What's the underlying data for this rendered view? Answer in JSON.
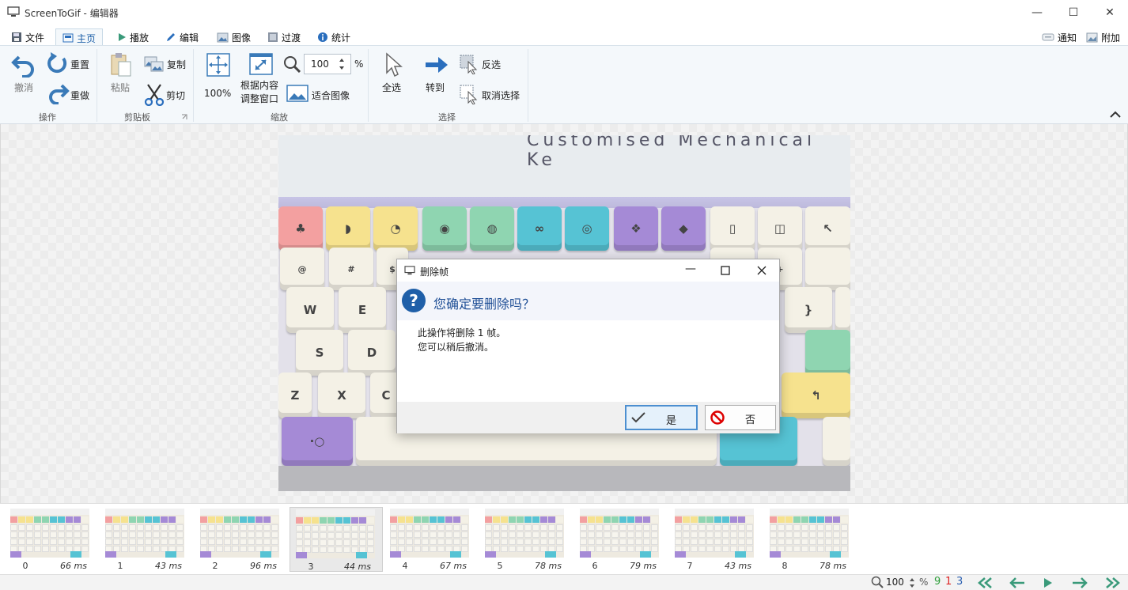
{
  "window": {
    "title": "ScreenToGif - 编辑器",
    "minimize_glyph": "—",
    "maximize_glyph": "☐",
    "close_glyph": "✕"
  },
  "tabs": [
    {
      "label": "文件",
      "icon": "save-icon"
    },
    {
      "label": "主页",
      "icon": "home-icon",
      "active": true
    },
    {
      "label": "播放",
      "icon": "play-icon"
    },
    {
      "label": "编辑",
      "icon": "pencil-icon"
    },
    {
      "label": "图像",
      "icon": "image-icon"
    },
    {
      "label": "过渡",
      "icon": "transition-icon"
    },
    {
      "label": "统计",
      "icon": "info-icon"
    }
  ],
  "right_tabs": [
    {
      "label": "通知",
      "icon": "notification-icon"
    },
    {
      "label": "附加",
      "icon": "extras-icon"
    }
  ],
  "ribbon": {
    "action": {
      "undo": "撤消",
      "reset": "重置",
      "redo": "重做",
      "group": "操作"
    },
    "clipboard": {
      "paste": "粘贴",
      "copy": "复制",
      "cut": "剪切",
      "group": "剪贴板"
    },
    "zoom": {
      "hundred": "100%",
      "fit_window": "根据内容\n调整窗口",
      "fit_image": "适合图像",
      "value": "100",
      "unit": "%",
      "group": "缩放"
    },
    "select": {
      "select_all": "全选",
      "goto": "转到",
      "invert": "反选",
      "deselect": "取消选择",
      "group": "选择"
    }
  },
  "frame_caption": "Customised Mechanical Ke",
  "dialog": {
    "title": "删除帧",
    "heading": "您确定要删除吗？",
    "line1": "此操作将删除 1 帧。",
    "line2": "您可以稍后撤消。",
    "yes": "是",
    "no": "否"
  },
  "frames": [
    {
      "num": "0",
      "dur": "66 ms"
    },
    {
      "num": "1",
      "dur": "43 ms"
    },
    {
      "num": "2",
      "dur": "96 ms"
    },
    {
      "num": "3",
      "dur": "44 ms",
      "selected": true
    },
    {
      "num": "4",
      "dur": "67 ms"
    },
    {
      "num": "5",
      "dur": "78 ms"
    },
    {
      "num": "6",
      "dur": "79 ms"
    },
    {
      "num": "7",
      "dur": "43 ms"
    },
    {
      "num": "8",
      "dur": "78 ms"
    }
  ],
  "status": {
    "zoom": "100",
    "unit": "%",
    "total": "9",
    "selected": "1",
    "current": "3",
    "colors": {
      "total": "#2e9e3a",
      "selected": "#d22",
      "current": "#2a5fb0"
    }
  },
  "colors": {
    "accent": "#2a6ebd",
    "arrow": "#3a7ab8",
    "teal": "#3a9a7a"
  }
}
